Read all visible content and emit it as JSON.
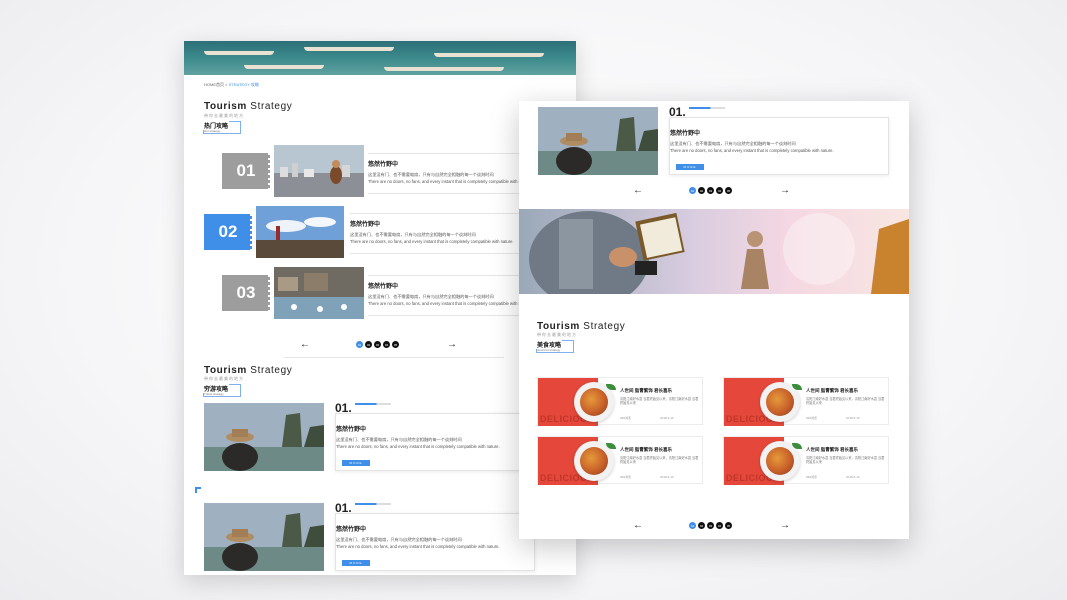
{
  "breadcrumb": {
    "home": "HOME首页",
    "sep": ">",
    "current": "STRATEGY 攻略"
  },
  "hot": {
    "title_bold": "Tourism",
    "title_rest": "Strategy",
    "subtitle": "带你去最美的地方",
    "tag_zh": "热门攻略",
    "tag_en": "Hot strategy",
    "items": [
      {
        "num": "01",
        "title": "悠然竹野中",
        "zh": "这里没有门、也不需要电扇，只有与自然完全相融的每一个谈刻时间",
        "en": "There are no doors, no fans, and every instant that is completely compatible with nature."
      },
      {
        "num": "02",
        "title": "悠然竹野中",
        "zh": "这里没有门、也不需要电扇，只有与自然完全相融的每一个谈刻时间",
        "en": "There are no doors, no fans, and every instant that is completely compatible with nature."
      },
      {
        "num": "03",
        "title": "悠然竹野中",
        "zh": "这里没有门、也不需要电扇，只有与自然完全相融的每一个谈刻时间",
        "en": "There are no doors, no fans, and every instant that is completely compatible with nature."
      }
    ]
  },
  "poor": {
    "title_bold": "Tourism",
    "title_rest": "Strategy",
    "subtitle": "带你去最美的地方",
    "tag_zh": "穷游攻略",
    "tag_en": "Travel strategy",
    "items": [
      {
        "num": "01.",
        "title": "悠然竹野中",
        "zh": "这里没有门、也不需要电扇，只有与自然完全相融的每一个谈刻时间",
        "en": "There are no doors, no fans, and every instant that is completely compatible with nature.",
        "more": "MORE"
      },
      {
        "num": "01.",
        "title": "悠然竹野中",
        "zh": "这里没有门、也不需要电扇，只有与自然完全相融的每一个谈刻时间",
        "en": "There are no doors, no fans, and every instant that is completely compatible with nature.",
        "more": "MORE"
      }
    ]
  },
  "right_top": {
    "num": "01.",
    "title": "悠然竹野中",
    "zh": "这里没有门、也不需要电扇，只有与自然完全相融的每一个谈刻时间",
    "en": "There are no doors, no fans, and every instant that is completely compatible with nature.",
    "more": "MORE"
  },
  "food": {
    "title_bold": "Tourism",
    "title_rest": "Strategy",
    "subtitle": "带你去最美的地方",
    "tag_zh": "美食攻略",
    "tag_en": "Gourmet strategy",
    "cards": [
      {
        "word": "DELICIOUS",
        "title": "人世间 脂膏繁饰 君长喜乐",
        "desc": "清阳江南好水县 当君终始见以来，清阳江南好水县 当君终始见以来",
        "views": "999浏览",
        "date": "2018-5-16"
      },
      {
        "word": "DELICIOUS",
        "title": "人世间 脂膏繁饰 君长喜乐",
        "desc": "清阳江南好水县 当君终始见以来，清阳江南好水县 当君终始见以来",
        "views": "999浏览",
        "date": "2018-5-16"
      },
      {
        "word": "DELICIOUS",
        "title": "人世间 脂膏繁饰 君长喜乐",
        "desc": "清阳江南好水县 当君终始见以来，清阳江南好水县 当君终始见以来",
        "views": "999浏览",
        "date": "2018-5-16"
      },
      {
        "word": "DELICIOUS",
        "title": "人世间 脂膏繁饰 君长喜乐",
        "desc": "清阳江南好水县 当君终始见以来，清阳江南好水县 当君终始见以来",
        "views": "999浏览",
        "date": "2018-5-16"
      }
    ]
  },
  "pager": {
    "prev": "←",
    "next": "→",
    "pages": [
      "01",
      "02",
      "03",
      "04",
      "05"
    ]
  },
  "colors": {
    "accent": "#3f8ee8",
    "food_red": "#e5483a",
    "numbox_gray": "#9d9d9d"
  }
}
